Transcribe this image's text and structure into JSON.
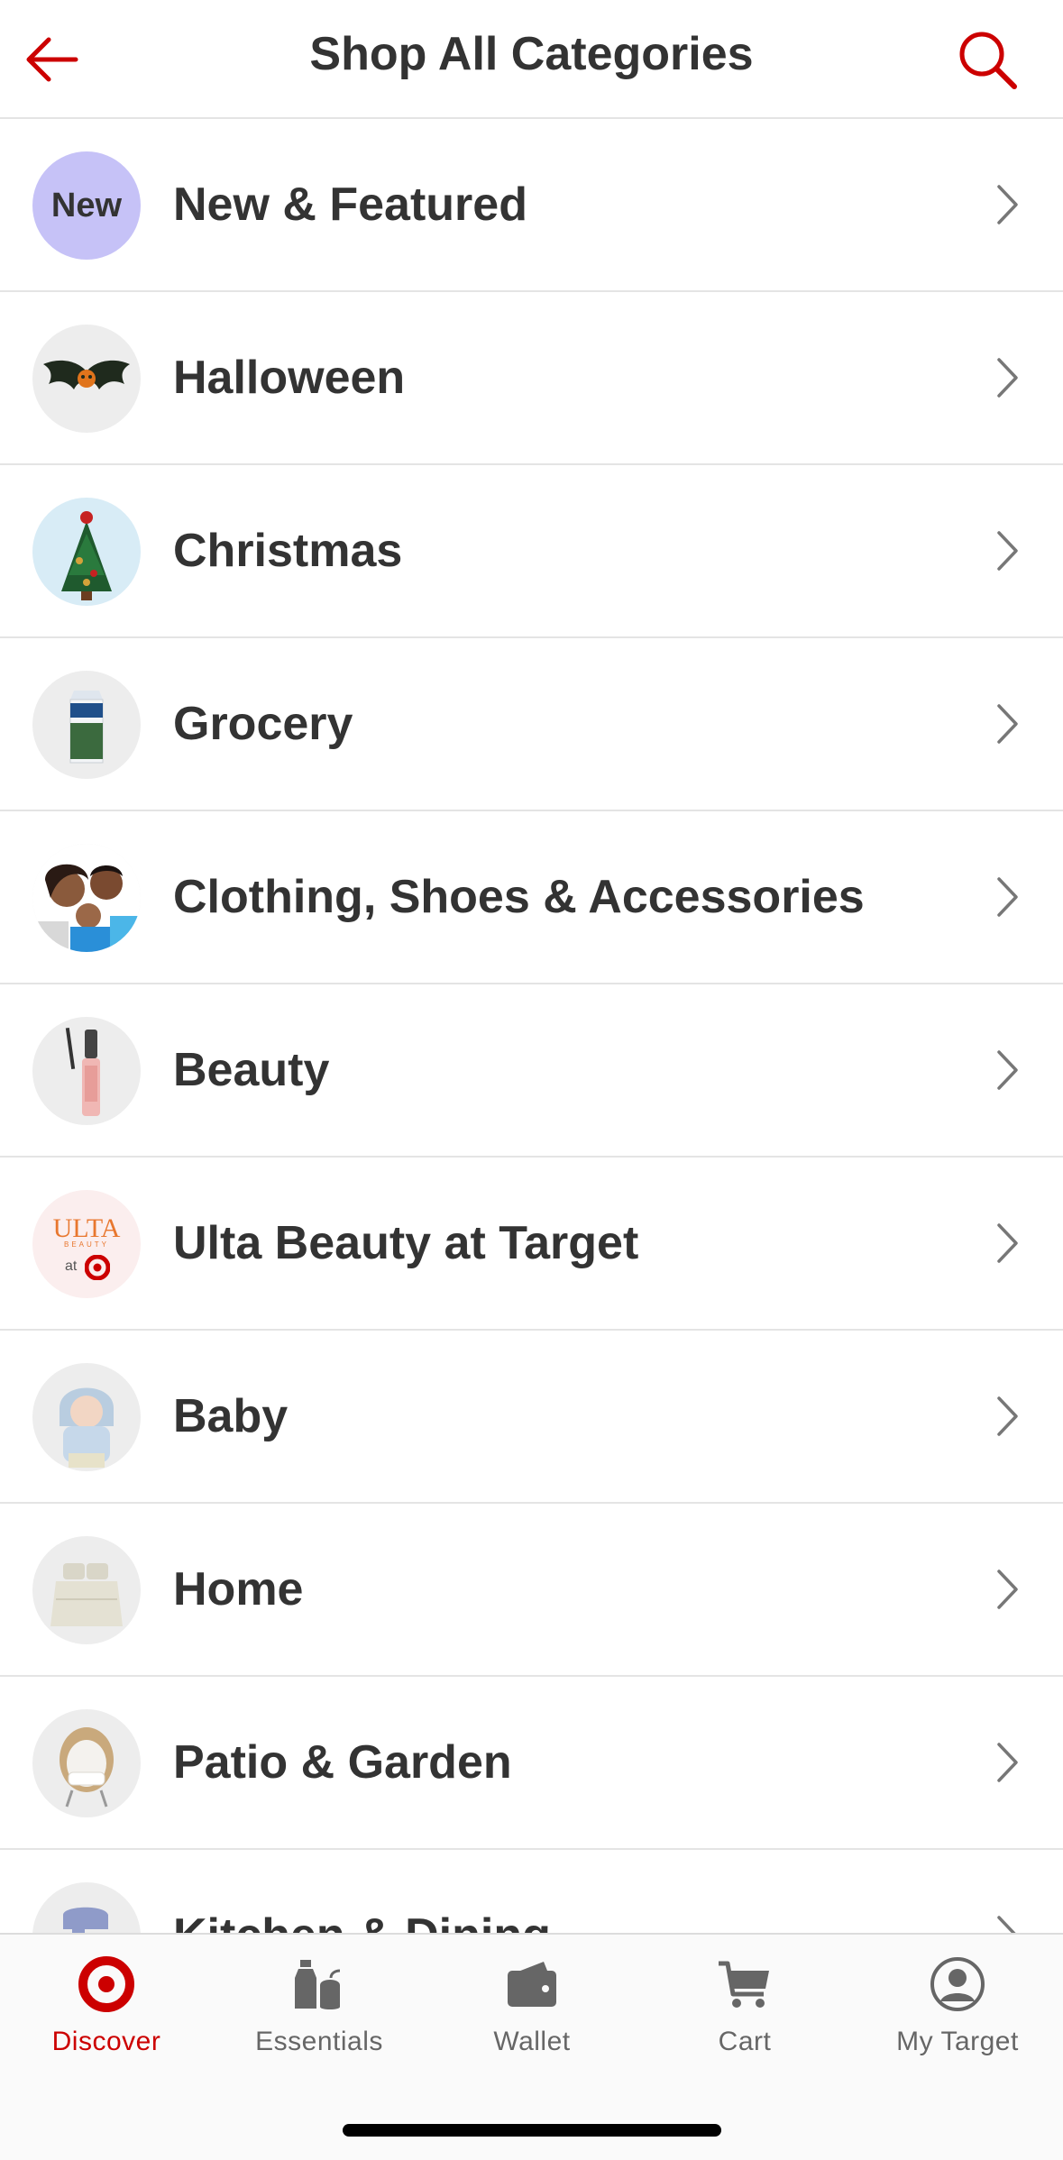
{
  "header": {
    "title": "Shop All Categories"
  },
  "categories": [
    {
      "label": "New & Featured",
      "thumb_text": "New"
    },
    {
      "label": "Halloween"
    },
    {
      "label": "Christmas"
    },
    {
      "label": "Grocery"
    },
    {
      "label": "Clothing, Shoes & Accessories"
    },
    {
      "label": "Beauty"
    },
    {
      "label": "Ulta Beauty at Target",
      "thumb_text": "ULTA",
      "thumb_subtext": "BEAUTY",
      "thumb_at": "at"
    },
    {
      "label": "Baby"
    },
    {
      "label": "Home"
    },
    {
      "label": "Patio & Garden"
    },
    {
      "label": "Kitchen & Dining"
    }
  ],
  "tabbar": {
    "tabs": [
      {
        "label": "Discover",
        "icon": "target-logo-icon",
        "active": true
      },
      {
        "label": "Essentials",
        "icon": "essentials-icon"
      },
      {
        "label": "Wallet",
        "icon": "wallet-icon"
      },
      {
        "label": "Cart",
        "icon": "cart-icon"
      },
      {
        "label": "My Target",
        "icon": "profile-icon"
      }
    ]
  },
  "colors": {
    "brand_red": "#cc0000",
    "text": "#333333",
    "divider": "#e4e4e4",
    "new_badge": "#c6c2f7",
    "inactive_tab": "#666666"
  }
}
